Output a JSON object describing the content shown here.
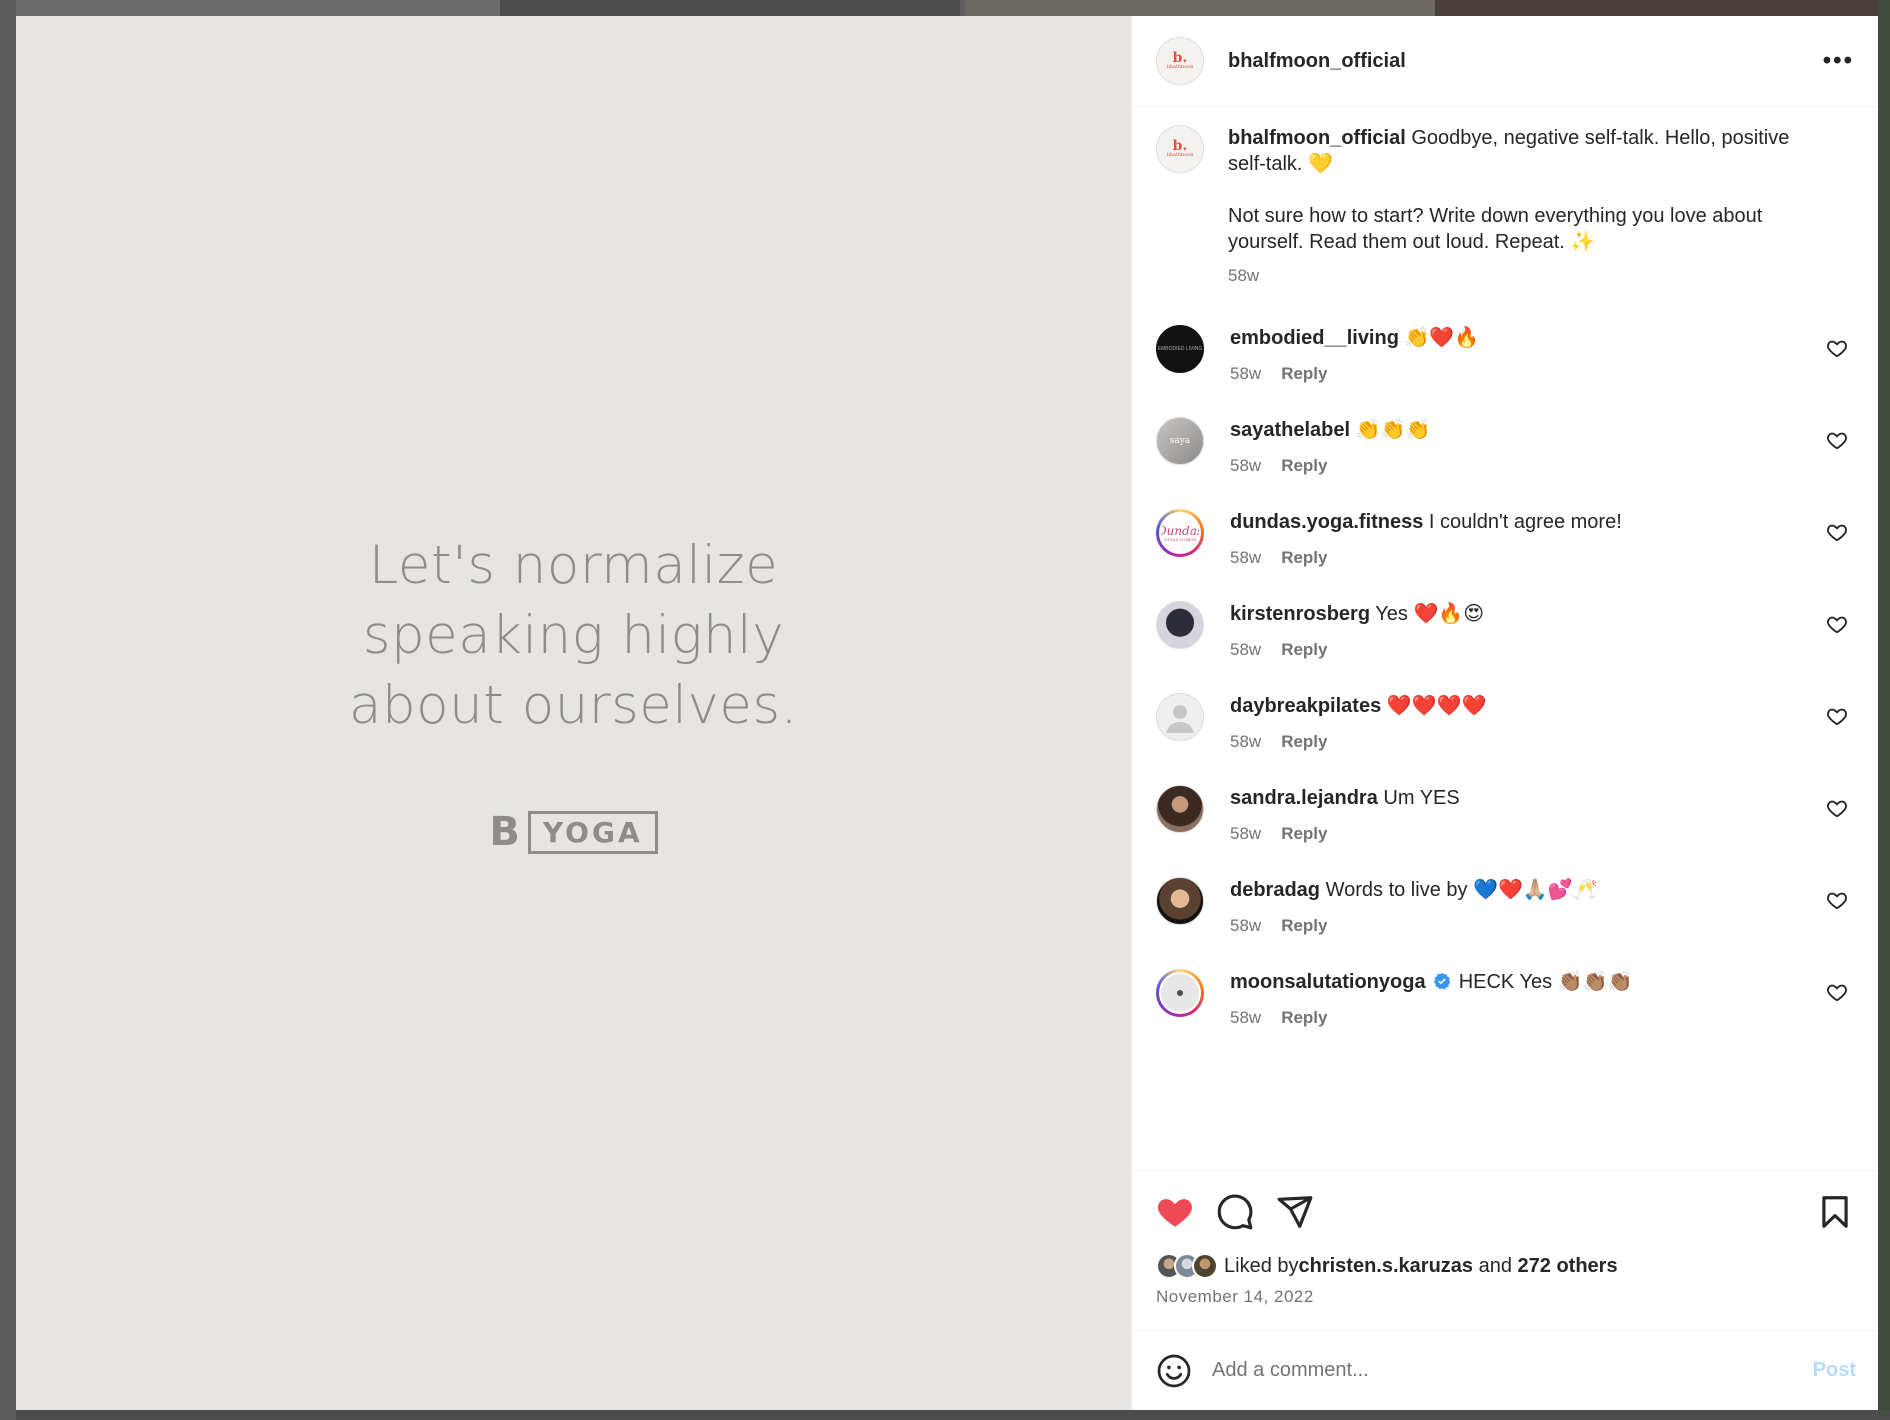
{
  "media": {
    "quote": "Let's normalize\nspeaking highly\nabout ourselves.",
    "brand_b": "B",
    "brand_yoga": "YOGA"
  },
  "header": {
    "username": "bhalfmoon_official",
    "avatar_logo_letter": "b.",
    "avatar_logo_name": "bhalfmoon",
    "more_icon": "more-horizontal-icon"
  },
  "caption": {
    "username": "bhalfmoon_official",
    "text": " Goodbye, negative self-talk. Hello, positive self-talk. 💛\n\nNot sure how to start? Write down everything you love about yourself. Read them out loud. Repeat. ✨",
    "time": "58w"
  },
  "comments": [
    {
      "username": "embodied__living",
      "text": " 👏❤️🔥",
      "time": "58w",
      "reply": "Reply",
      "avatar_text": "EMBODIED LIVING"
    },
    {
      "username": "sayathelabel",
      "text": " 👏👏👏",
      "time": "58w",
      "reply": "Reply",
      "avatar_text": "saya"
    },
    {
      "username": "dundas.yoga.fitness",
      "text": " I couldn't agree more!",
      "time": "58w",
      "reply": "Reply",
      "avatar_text": "Dundas",
      "avatar_sub": "YOGA & FITNESS"
    },
    {
      "username": "kirstenrosberg",
      "text": " Yes ❤️🔥😍",
      "time": "58w",
      "reply": "Reply"
    },
    {
      "username": "daybreakpilates",
      "text": " ❤️❤️❤️❤️",
      "time": "58w",
      "reply": "Reply"
    },
    {
      "username": "sandra.lejandra",
      "text": " Um YES",
      "time": "58w",
      "reply": "Reply"
    },
    {
      "username": "debradag",
      "text": " Words to live by 💙❤️🙏🏼💕🥂",
      "time": "58w",
      "reply": "Reply"
    },
    {
      "username": "moonsalutationyoga",
      "text": " HECK Yes 👏🏽👏🏽👏🏽",
      "time": "58w",
      "reply": "Reply",
      "verified": true
    }
  ],
  "actions": {
    "like_icon": "heart-filled-icon",
    "comment_icon": "comment-icon",
    "share_icon": "share-icon",
    "save_icon": "bookmark-icon",
    "like_color": "#ed4956"
  },
  "likes": {
    "prefix": "Liked by ",
    "user": "christen.s.karuzas",
    "middle": " and ",
    "others": "272 others"
  },
  "post_date": "November 14, 2022",
  "add_comment": {
    "placeholder": "Add a comment...",
    "post_label": "Post",
    "emoji_icon": "smiley-icon"
  }
}
